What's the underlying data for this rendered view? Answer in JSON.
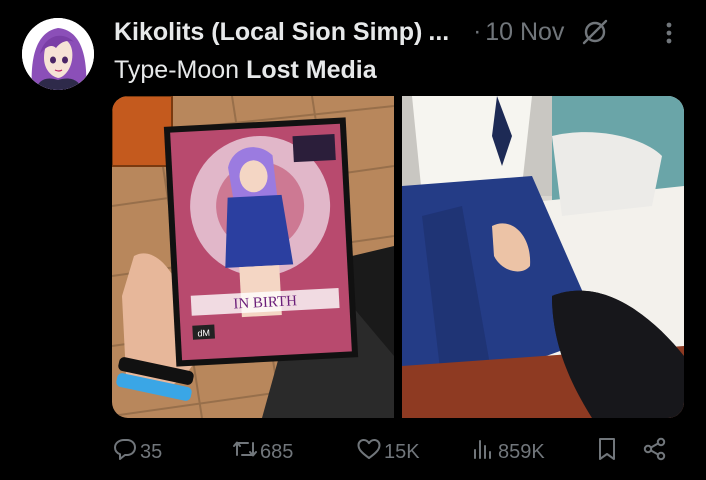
{
  "post": {
    "author": {
      "display_name": "Kikolits (Local Sion Simp)",
      "truncation": "...",
      "avatar": "anime-character-avatar"
    },
    "separator": "·",
    "timestamp": "10 Nov",
    "community": {
      "prefix": "Type-Moon",
      "name": "Lost Media"
    },
    "media": [
      {
        "type": "photo",
        "description_icon": "dvd-cover-photo",
        "cover_title": "IN BIRTH",
        "cover_corner_text": "dM"
      },
      {
        "type": "photo",
        "description_icon": "cosplay-photo"
      }
    ],
    "actions": {
      "replies": "35",
      "reposts": "685",
      "likes": "15K",
      "views": "859K"
    },
    "icons": {
      "reply": "speech-bubble-icon",
      "repost": "repost-arrows-icon",
      "like": "heart-icon",
      "views": "bar-chart-icon",
      "bookmark": "bookmark-icon",
      "share": "share-icon",
      "more": "more-vertical-icon",
      "grok": "slash-circle-icon"
    },
    "colors": {
      "background": "#000000",
      "primary_text": "#e7e9ea",
      "secondary_text": "#71767b"
    }
  }
}
